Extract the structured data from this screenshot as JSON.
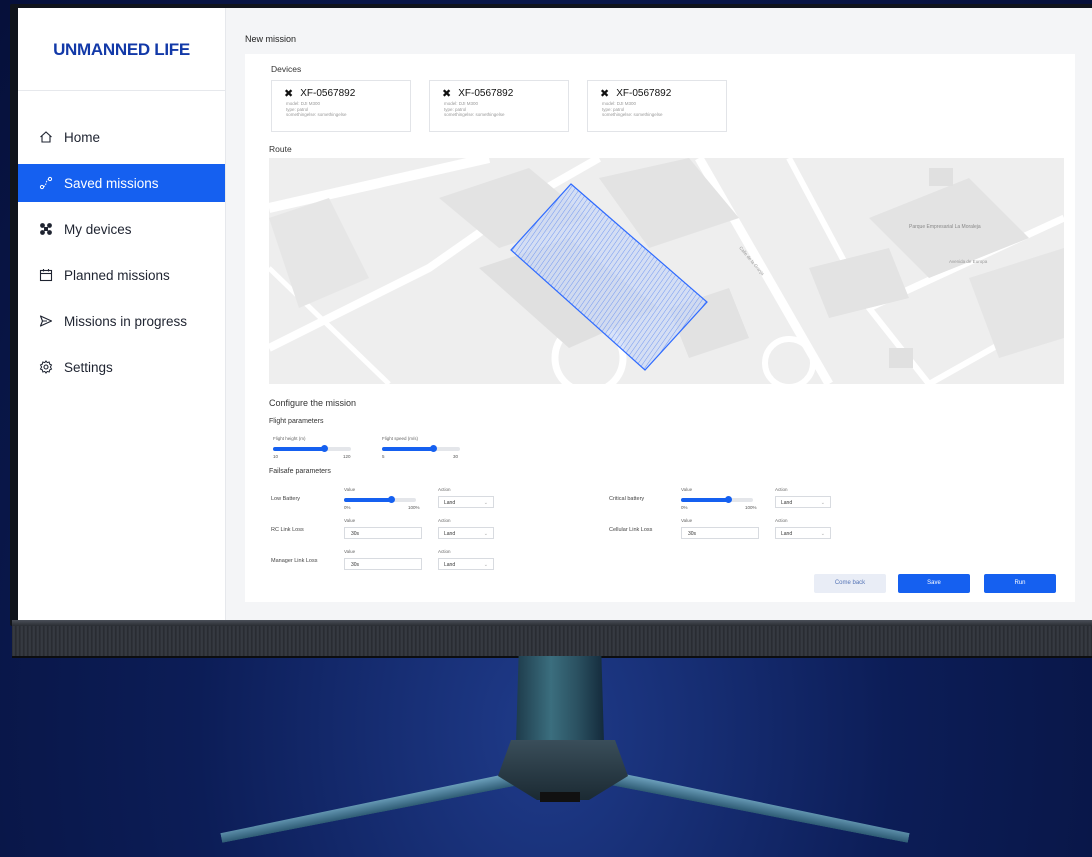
{
  "app": {
    "logo": "UNMANNED LIFE"
  },
  "sidebar": {
    "items": [
      {
        "label": "Home",
        "icon": "home-icon",
        "active": false
      },
      {
        "label": "Saved missions",
        "icon": "route-icon",
        "active": true
      },
      {
        "label": "My devices",
        "icon": "drone-icon",
        "active": false
      },
      {
        "label": "Planned missions",
        "icon": "calendar-icon",
        "active": false
      },
      {
        "label": "Missions in progress",
        "icon": "send-icon",
        "active": false
      },
      {
        "label": "Settings",
        "icon": "gear-icon",
        "active": false
      }
    ]
  },
  "main": {
    "title": "New mission",
    "devices_label": "Devices",
    "devices": [
      {
        "name": "XF-0567892",
        "model": "model: DJI M300",
        "type": "type: patrol",
        "extra": "somethingelse: somethingelse"
      },
      {
        "name": "XF-0567892",
        "model": "model: DJI M300",
        "type": "type: patrol",
        "extra": "somethingelse: somethingelse"
      },
      {
        "name": "XF-0567892",
        "model": "model: DJI M300",
        "type": "type: patrol",
        "extra": "somethingelse: somethingelse"
      }
    ],
    "route_label": "Route",
    "map_labels": [
      "Parque Empresarial La Moraleja",
      "Avenida de Europa",
      "Calle de la Granja"
    ],
    "configure_label": "Configure the mission",
    "flight_params_label": "Flight parameters",
    "flight_height": {
      "label": "Flight height (m)",
      "min": "10",
      "max": "120",
      "fraction": 0.65
    },
    "flight_speed": {
      "label": "Flight speed (m/s)",
      "min": "5",
      "max": "30",
      "fraction": 0.65
    },
    "failsafe_label": "Failsafe parameters",
    "failsafe": {
      "value_caption": "Value",
      "action_caption": "Action",
      "low_battery": {
        "label": "Low Battery",
        "min": "0%",
        "max": "100%",
        "fraction": 0.65,
        "action": "Land"
      },
      "critical_battery": {
        "label": "Critical battery",
        "min": "0%",
        "max": "100%",
        "fraction": 0.65,
        "action": "Land"
      },
      "rc_link_loss": {
        "label": "RC Link Loss",
        "value": "30s",
        "action": "Land"
      },
      "cellular_link_loss": {
        "label": "Cellular Link Loss",
        "value": "30s",
        "action": "Land"
      },
      "manager_link_loss": {
        "label": "Manager Link Loss",
        "value": "30s",
        "action": "Land"
      }
    },
    "buttons": {
      "come_back": "Come back",
      "save": "Save",
      "run": "Run"
    }
  },
  "colors": {
    "accent": "#1560f0",
    "logo": "#1239a8"
  }
}
